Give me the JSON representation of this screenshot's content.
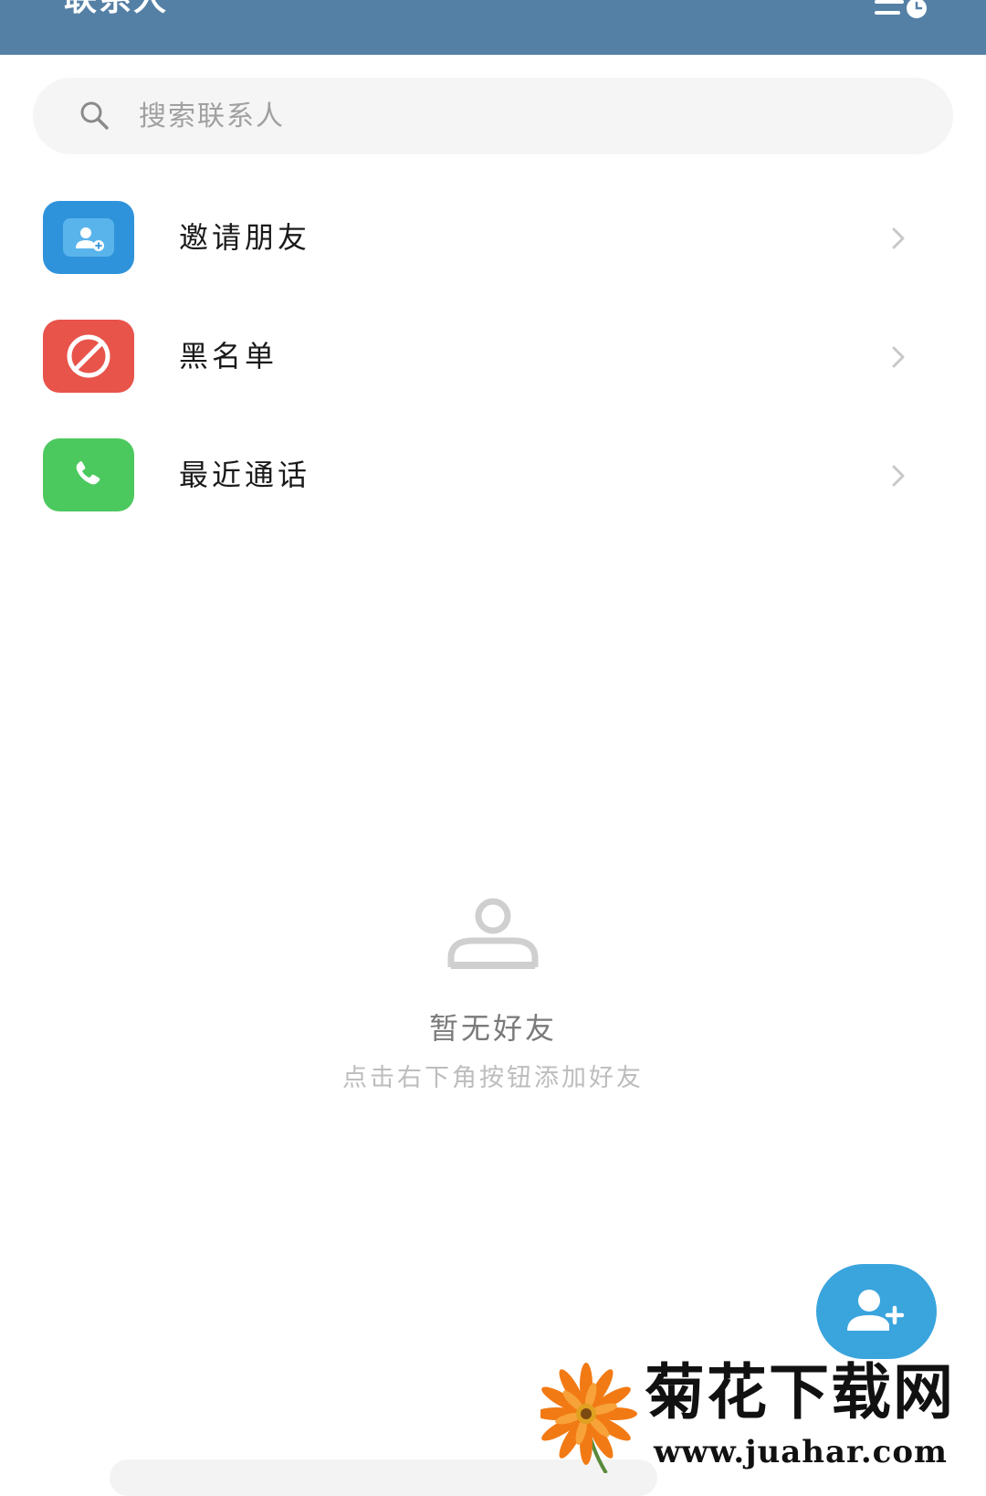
{
  "header": {
    "title": "联系人",
    "action_icon": "list-clock-icon"
  },
  "search": {
    "placeholder": "搜索联系人",
    "icon": "search-icon"
  },
  "menu": [
    {
      "label": "邀请朋友",
      "icon": "invite-friend-icon",
      "color": "#2f93db"
    },
    {
      "label": "黑名单",
      "icon": "block-icon",
      "color": "#e8534a"
    },
    {
      "label": "最近通话",
      "icon": "phone-icon",
      "color": "#4cc95e"
    }
  ],
  "empty_state": {
    "title": "暂无好友",
    "hint": "点击右下角按钮添加好友",
    "icon": "person-outline-icon"
  },
  "fab": {
    "icon": "add-person-icon",
    "color": "#3aa4dd"
  },
  "watermark": {
    "title": "菊花下载网",
    "url": "www.juahar.com"
  },
  "colors": {
    "header": "#5580a6",
    "search_bg": "#f5f5f5",
    "chevron": "#c8c8c8"
  }
}
